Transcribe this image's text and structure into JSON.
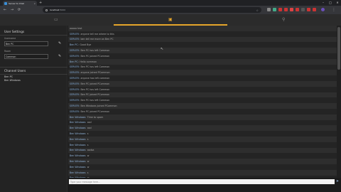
{
  "browser": {
    "tab_title": "Server to Chat",
    "tab_close": "×",
    "new_tab": "+",
    "url_host": "localhost",
    "url_path": ":5000",
    "win_min": "–",
    "win_max": "□",
    "win_close": "✕"
  },
  "sidebar": {
    "settings_title": "User Settings",
    "username_label": "Username",
    "username_value": "Ben PC",
    "room_label": "Room",
    "room_value": "Common",
    "users_title": "Channel Users",
    "users": [
      "Ben PC",
      "Ben Windows"
    ]
  },
  "chat": {
    "messages": [
      {
        "sender": "",
        "text": "ooooo test",
        "server": false
      },
      {
        "sender": "SERVER:",
        "text": "anyone tell me where to this",
        "server": true
      },
      {
        "sender": "SERVER:",
        "text": "ben tell me more on Ben PC",
        "server": true
      },
      {
        "sender": "Ben PC:",
        "text": "Good Bye",
        "server": false
      },
      {
        "sender": "SERVER:",
        "text": "Ben PC has left Common",
        "server": true
      },
      {
        "sender": "SERVER:",
        "text": "Ben PC joined PCommon",
        "server": true
      },
      {
        "sender": "Ben PC:",
        "text": "Hello common",
        "server": false
      },
      {
        "sender": "SERVER:",
        "text": "Ben PC has left Common",
        "server": true
      },
      {
        "sender": "SERVER:",
        "text": "anyone joined PCommon",
        "server": true
      },
      {
        "sender": "SERVER:",
        "text": "anyone has left common",
        "server": true
      },
      {
        "sender": "SERVER:",
        "text": "Ben PC joined PCommon",
        "server": true
      },
      {
        "sender": "SERVER:",
        "text": "Ben PC has left Common",
        "server": true
      },
      {
        "sender": "SERVER:",
        "text": "Ben PC joined PCommon",
        "server": true
      },
      {
        "sender": "SERVER:",
        "text": "Ben PC has left Common",
        "server": true
      },
      {
        "sender": "SERVER:",
        "text": "Ben Windows joined PCommon",
        "server": true
      },
      {
        "sender": "SERVER:",
        "text": "Ben PC joined PCommon",
        "server": true
      },
      {
        "sender": "Ben Windows:",
        "text": "Time to spam",
        "server": false
      },
      {
        "sender": "Ben Windows:",
        "text": "asd",
        "server": false
      },
      {
        "sender": "Ben Windows:",
        "text": "asd",
        "server": false
      },
      {
        "sender": "Ben Windows:",
        "text": "s",
        "server": false
      },
      {
        "sender": "Ben Windows:",
        "text": "s",
        "server": false
      },
      {
        "sender": "Ben Windows:",
        "text": "s",
        "server": false
      },
      {
        "sender": "Ben Windows:",
        "text": "asdsa",
        "server": false
      },
      {
        "sender": "Ben Windows:",
        "text": "w",
        "server": false
      },
      {
        "sender": "Ben Windows:",
        "text": "w",
        "server": false
      },
      {
        "sender": "Ben Windows:",
        "text": "w",
        "server": false
      },
      {
        "sender": "Ben Windows:",
        "text": "s",
        "server": false
      },
      {
        "sender": "Ben Windows:",
        "text": "w",
        "server": false
      }
    ]
  },
  "input": {
    "placeholder": "Type your message here...",
    "send_glyph": "➤"
  },
  "colors": {
    "accent": "#e5a52a",
    "server_sender": "#7fa6d0"
  }
}
